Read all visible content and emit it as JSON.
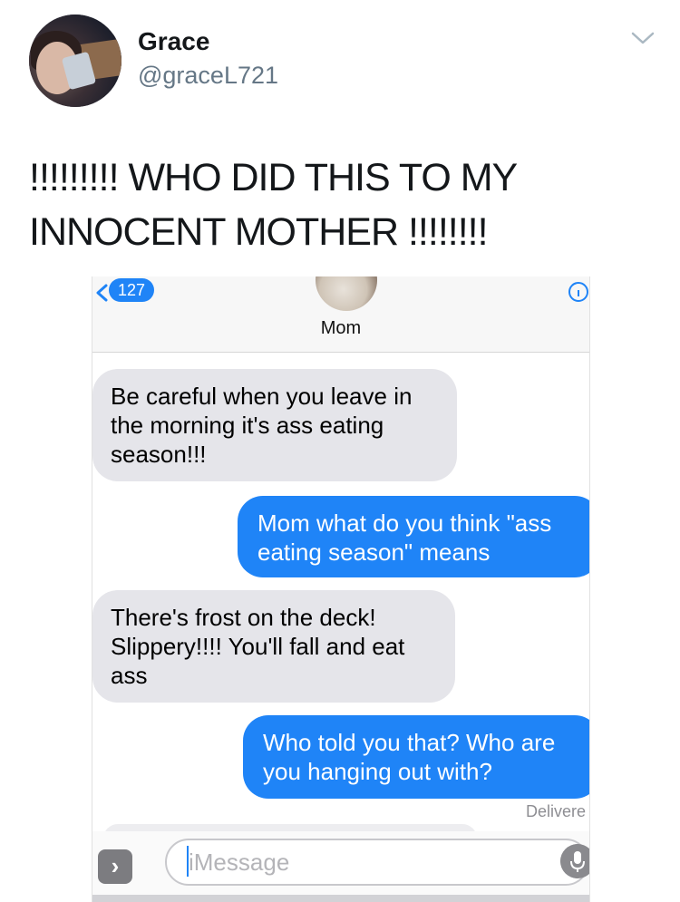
{
  "tweet": {
    "author_name": "Grace",
    "author_handle": "@graceL721",
    "text_line1": "!!!!!!!!! WHO DID THIS TO MY",
    "text_line2": "INNOCENT MOTHER !!!!!!!!"
  },
  "screenshot": {
    "back_badge": "127",
    "contact_name": "Mom",
    "messages": [
      {
        "direction": "received",
        "text": "Be careful when you leave in the morning it's ass eating season!!!"
      },
      {
        "direction": "sent",
        "text": "Mom what do you think \"ass eating season\" means"
      },
      {
        "direction": "received",
        "text": "There's frost on the deck! Slippery!!!! You'll fall and eat ass"
      },
      {
        "direction": "sent",
        "text": "Who told you that? Who are you hanging out with?"
      }
    ],
    "status": "Delivere",
    "composer_placeholder": "iMessage"
  },
  "colors": {
    "imessage_blue": "#1f84f7",
    "received_gray": "#e5e5ea",
    "twitter_handle_gray": "#657786"
  },
  "icons": [
    "chevron-down-icon",
    "back-chevron-icon",
    "info-icon",
    "app-drawer-icon",
    "microphone-icon"
  ]
}
